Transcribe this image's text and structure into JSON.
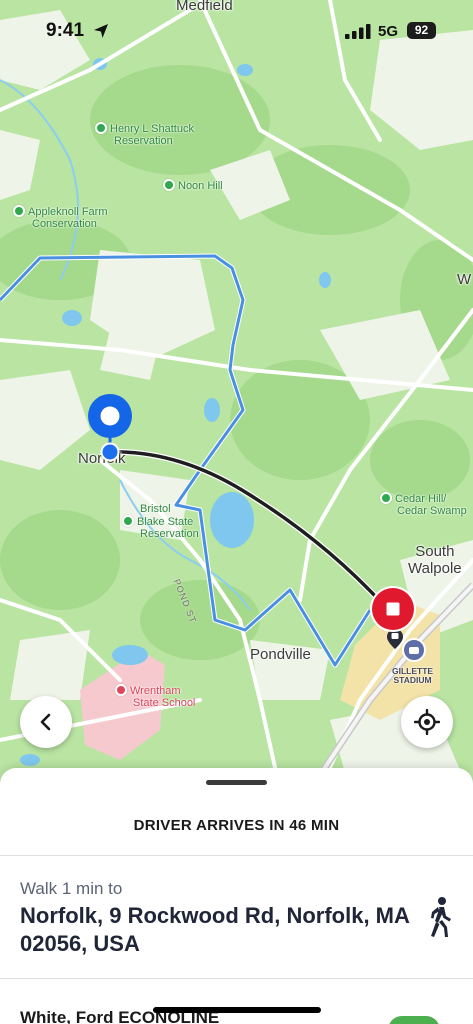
{
  "status_bar": {
    "time": "9:41",
    "network": "5G",
    "battery": "92"
  },
  "map": {
    "towns": {
      "medfield": "Medfield",
      "norfolk": "Norfolk",
      "south_walpole_1": "South",
      "south_walpole_2": "Walpole",
      "pondville": "Pondville",
      "walpole_partial": "W"
    },
    "parks": {
      "shattuck_1": "Henry L Shattuck",
      "shattuck_2": "Reservation",
      "noon_hill": "Noon Hill",
      "appleknoll_1": "Appleknoll Farm",
      "appleknoll_2": "Conservation",
      "bristol_1": "Bristol",
      "bristol_2": "Blake State",
      "bristol_3": "Reservation",
      "cedar_1": "Cedar Hill/",
      "cedar_2": "Cedar Swamp"
    },
    "poi": {
      "wrentham_1": "Wrentham",
      "wrentham_2": "State School",
      "stadium_1": "GILLETTE",
      "stadium_2": "STADIUM"
    },
    "roads": {
      "pond_st": "POND ST"
    },
    "colors": {
      "map_green": "#b9e4a2",
      "boundary_blue": "#4a90e2",
      "pickup_pin": "#1565e8",
      "destination_pin": "#e0192f",
      "route": "#1e1e1e"
    },
    "icons": {
      "back": "chevron-left-icon",
      "locate": "crosshair-icon",
      "pickup": "location-pin-icon",
      "destination": "stop-square-icon"
    }
  },
  "sheet": {
    "eta": "DRIVER ARRIVES IN 46 MIN",
    "walk_label": "Walk 1 min to",
    "pickup_address": "Norfolk, 9 Rockwood Rd, Norfolk, MA 02056, USA",
    "vehicle": "White, Ford ECONOLINE",
    "walker_icon": "walking-person-icon"
  }
}
